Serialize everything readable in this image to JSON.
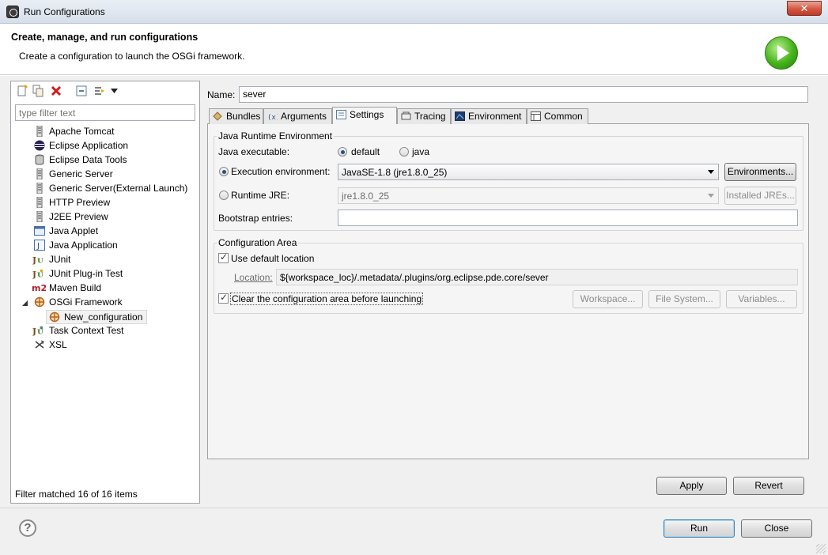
{
  "window": {
    "title": "Run Configurations",
    "close_label": "✕"
  },
  "header": {
    "title": "Create, manage, and run configurations",
    "subtitle": "Create a configuration to launch the OSGi framework."
  },
  "left": {
    "filter_placeholder": "type filter text",
    "tree": [
      {
        "label": "Apache Tomcat",
        "icon": "server-icon"
      },
      {
        "label": "Eclipse Application",
        "icon": "eclipse-icon"
      },
      {
        "label": "Eclipse Data Tools",
        "icon": "database-icon"
      },
      {
        "label": "Generic Server",
        "icon": "server-icon"
      },
      {
        "label": "Generic Server(External Launch)",
        "icon": "server-icon"
      },
      {
        "label": "HTTP Preview",
        "icon": "server-icon"
      },
      {
        "label": "J2EE Preview",
        "icon": "server-icon"
      },
      {
        "label": "Java Applet",
        "icon": "applet-icon"
      },
      {
        "label": "Java Application",
        "icon": "java-app-icon"
      },
      {
        "label": "JUnit",
        "icon": "junit-icon"
      },
      {
        "label": "JUnit Plug-in Test",
        "icon": "junit-plugin-icon"
      },
      {
        "label": "Maven Build",
        "icon": "maven-icon"
      },
      {
        "label": "OSGi Framework",
        "icon": "osgi-icon",
        "expanded": true
      },
      {
        "label": "New_configuration",
        "icon": "osgi-config-icon",
        "selected": true,
        "child": true
      },
      {
        "label": "Task Context Test",
        "icon": "task-context-icon"
      },
      {
        "label": "XSL",
        "icon": "xsl-icon"
      }
    ],
    "status": "Filter matched 16 of 16 items"
  },
  "config": {
    "name_label": "Name:",
    "name_value": "sever",
    "tabs": [
      {
        "label": "Bundles",
        "icon": "bundles-icon"
      },
      {
        "label": "Arguments",
        "icon": "arguments-icon"
      },
      {
        "label": "Settings",
        "icon": "settings-icon",
        "active": true
      },
      {
        "label": "Tracing",
        "icon": "tracing-icon"
      },
      {
        "label": "Environment",
        "icon": "environment-icon"
      },
      {
        "label": "Common",
        "icon": "common-icon"
      }
    ],
    "jre_group": {
      "title": "Java Runtime Environment",
      "java_exec_label": "Java executable:",
      "default_label": "default",
      "java_label": "java",
      "exec_env_label": "Execution environment:",
      "exec_env_value": "JavaSE-1.8 (jre1.8.0_25)",
      "environments_button": "Environments...",
      "runtime_jre_label": "Runtime JRE:",
      "runtime_jre_value": "jre1.8.0_25",
      "installed_jres_button": "Installed JREs...",
      "bootstrap_label": "Bootstrap entries:",
      "bootstrap_value": ""
    },
    "config_area": {
      "title": "Configuration Area",
      "use_default_label": "Use default location",
      "location_label": "Location:",
      "location_value": "${workspace_loc}/.metadata/.plugins/org.eclipse.pde.core/sever",
      "clear_label": "Clear the configuration area before launching",
      "workspace_button": "Workspace...",
      "filesystem_button": "File System...",
      "variables_button": "Variables..."
    },
    "apply_button": "Apply",
    "revert_button": "Revert"
  },
  "footer": {
    "help_label": "?",
    "run_button": "Run",
    "close_button": "Close"
  }
}
